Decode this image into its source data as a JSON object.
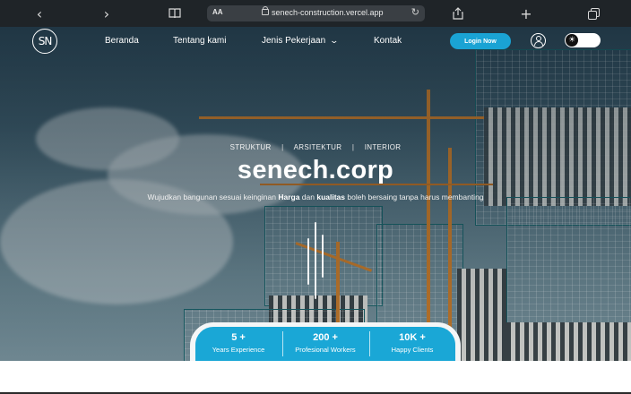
{
  "browser": {
    "text_size_label": "AA",
    "url": "senech-construction.vercel.app"
  },
  "nav": {
    "logo_text": "SN",
    "links": [
      "Beranda",
      "Tentang kami",
      "Jenis Pekerjaan",
      "Kontak"
    ],
    "login_label": "Login Now"
  },
  "hero": {
    "categories": [
      "STRUKTUR",
      "ARSITEKTUR",
      "INTERIOR"
    ],
    "category_separator": "|",
    "title": "senech.corp",
    "tagline_part1": "Wujudkan bangunan sesuai keinginan ",
    "tagline_bold1": "Harga",
    "tagline_part2": " dan ",
    "tagline_bold2": "kualitas",
    "tagline_part3": " boleh bersaing tanpa harus membanting"
  },
  "stats": [
    {
      "value": "5 +",
      "label": "Years Experience"
    },
    {
      "value": "200 +",
      "label": "Profesional Workers"
    },
    {
      "value": "10K +",
      "label": "Happy Clients"
    }
  ],
  "icons": {
    "back": "chevron-left-icon",
    "forward": "chevron-right-icon",
    "bookmarks": "book-icon",
    "reload": "reload-icon",
    "share": "share-icon",
    "new_tab": "plus-icon",
    "tabs": "tabs-icon",
    "user": "user-icon",
    "theme": "sun-icon"
  },
  "colors": {
    "accent": "#1aa7d6",
    "browser_bar": "#1f2428"
  }
}
